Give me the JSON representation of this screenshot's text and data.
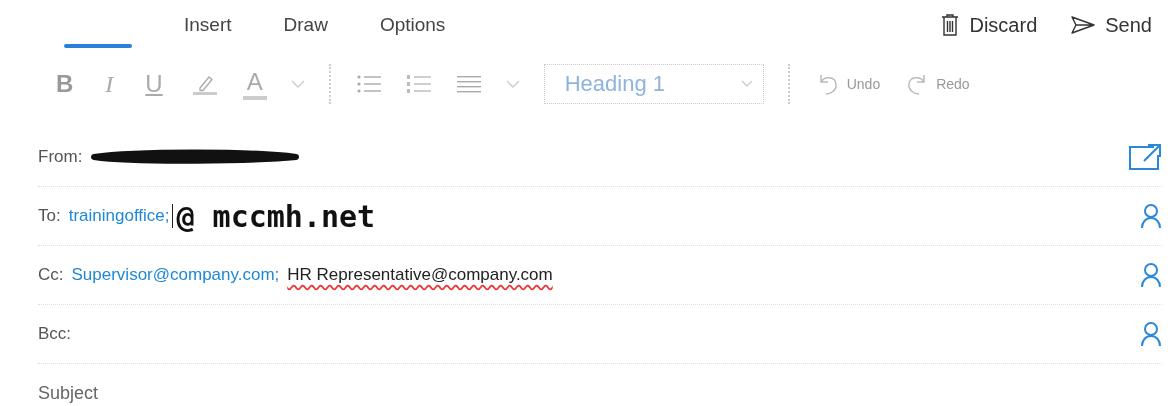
{
  "tabs": [
    {
      "selected": true
    },
    {
      "label": "Insert",
      "selected": false
    },
    {
      "label": "Draw",
      "selected": false
    },
    {
      "label": "Options",
      "selected": false
    }
  ],
  "actions": [
    {
      "kind": "discard",
      "label": "Discard"
    },
    {
      "kind": "send",
      "label": "Send"
    }
  ],
  "toolbar": [
    {
      "kind": "bold",
      "glyph": "B"
    },
    {
      "kind": "italic",
      "glyph": "I"
    },
    {
      "kind": "underline",
      "glyph": "U"
    },
    {
      "kind": "highlight"
    },
    {
      "kind": "fontcolor",
      "glyph": "A"
    },
    {
      "kind": "caret"
    },
    {
      "kind": "divider"
    },
    {
      "kind": "bullets"
    },
    {
      "kind": "numbering"
    },
    {
      "kind": "align"
    },
    {
      "kind": "caret"
    },
    {
      "kind": "style",
      "value": "Heading 1"
    },
    {
      "kind": "divider"
    },
    {
      "kind": "undo",
      "label": "Undo"
    },
    {
      "kind": "redo",
      "label": "Redo"
    }
  ],
  "fields": [
    {
      "kind": "from",
      "label": "From:",
      "redacted": true
    },
    {
      "kind": "recipients",
      "label": "To:",
      "recipients": [
        {
          "text": "trainingoffice;",
          "resolved": true
        }
      ],
      "handwriting": "@ mccmh.net"
    },
    {
      "kind": "recipients",
      "label": "Cc:",
      "recipients": [
        {
          "text": "Supervisor@company.com;",
          "resolved": true
        },
        {
          "text": "HR Representative@company.com",
          "resolved": false
        }
      ]
    },
    {
      "kind": "recipients",
      "label": "Bcc:"
    },
    {
      "kind": "subject",
      "placeholder": "Subject"
    }
  ]
}
